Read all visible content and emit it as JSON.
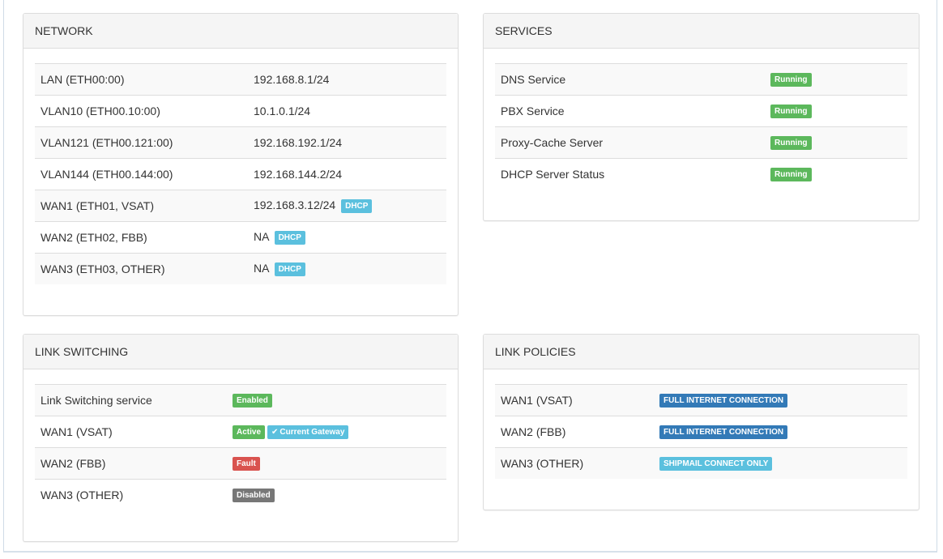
{
  "network": {
    "title": "NETWORK",
    "rows": [
      {
        "name": "LAN (ETH00:00)",
        "value": "192.168.8.1/24",
        "badge": ""
      },
      {
        "name": "VLAN10 (ETH00.10:00)",
        "value": "10.1.0.1/24",
        "badge": ""
      },
      {
        "name": "VLAN121 (ETH00.121:00)",
        "value": "192.168.192.1/24",
        "badge": ""
      },
      {
        "name": "VLAN144 (ETH00.144:00)",
        "value": "192.168.144.2/24",
        "badge": ""
      },
      {
        "name": "WAN1 (ETH01, VSAT)",
        "value": "192.168.3.12/24",
        "badge": "DHCP"
      },
      {
        "name": "WAN2 (ETH02, FBB)",
        "value": "NA",
        "badge": "DHCP"
      },
      {
        "name": "WAN3 (ETH03, OTHER)",
        "value": "NA",
        "badge": "DHCP"
      }
    ]
  },
  "services": {
    "title": "SERVICES",
    "rows": [
      {
        "name": "DNS Service",
        "status": "Running"
      },
      {
        "name": "PBX Service",
        "status": "Running"
      },
      {
        "name": "Proxy-Cache Server",
        "status": "Running"
      },
      {
        "name": "DHCP Server Status",
        "status": "Running"
      }
    ]
  },
  "link_switching": {
    "title": "LINK SWITCHING",
    "rows": [
      {
        "name": "Link Switching service",
        "status": "Enabled",
        "status_color": "#5cb85c",
        "extra": ""
      },
      {
        "name": "WAN1 (VSAT)",
        "status": "Active",
        "status_color": "#5cb85c",
        "extra": "Current Gateway",
        "extra_icon": "check-icon"
      },
      {
        "name": "WAN2 (FBB)",
        "status": "Fault",
        "status_color": "#d9534f",
        "extra": ""
      },
      {
        "name": "WAN3 (OTHER)",
        "status": "Disabled",
        "status_color": "#777777",
        "extra": ""
      }
    ]
  },
  "link_policies": {
    "title": "LINK POLICIES",
    "rows": [
      {
        "name": "WAN1 (VSAT)",
        "policy": "FULL INTERNET CONNECTION",
        "policy_color": "#337ab7"
      },
      {
        "name": "WAN2 (FBB)",
        "policy": "FULL INTERNET CONNECTION",
        "policy_color": "#337ab7"
      },
      {
        "name": "WAN3 (OTHER)",
        "policy": "SHIPMAIL CONNECT ONLY",
        "policy_color": "#5bc0de"
      }
    ]
  },
  "colors": {
    "success": "#5cb85c",
    "info": "#5bc0de",
    "danger": "#d9534f",
    "default": "#777777",
    "primary": "#337ab7"
  }
}
